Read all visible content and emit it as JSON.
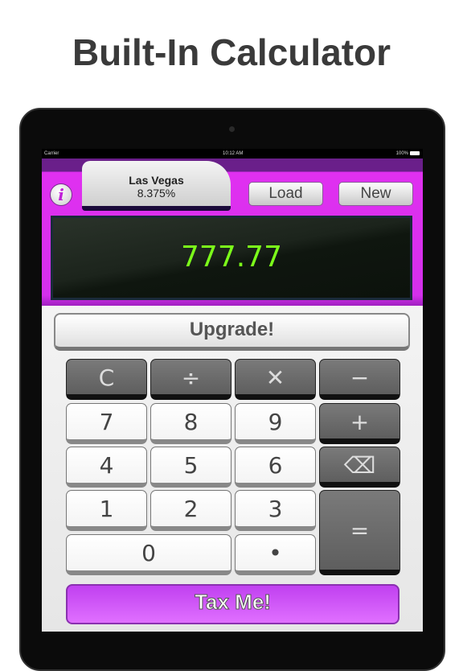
{
  "headline": "Built-In Calculator",
  "status_bar": {
    "carrier": "Carrier",
    "time": "10:12 AM",
    "battery": "100%"
  },
  "header": {
    "info_icon": "i",
    "location": "Las Vegas",
    "tax_rate": "8.375%",
    "load_label": "Load",
    "new_label": "New"
  },
  "display": {
    "value": "777.77"
  },
  "upgrade_label": "Upgrade!",
  "keys": {
    "clear": "C",
    "divide": "÷",
    "multiply": "✕",
    "minus": "−",
    "plus": "+",
    "backspace": "⌫",
    "equals": "=",
    "dot": "•",
    "d7": "7",
    "d8": "8",
    "d9": "9",
    "d4": "4",
    "d5": "5",
    "d6": "6",
    "d1": "1",
    "d2": "2",
    "d3": "3",
    "d0": "0"
  },
  "tax_label": "Tax Me!",
  "colors": {
    "header": "#d430ec",
    "display_text": "#7cff1a",
    "tax_button": "#d060f8"
  }
}
